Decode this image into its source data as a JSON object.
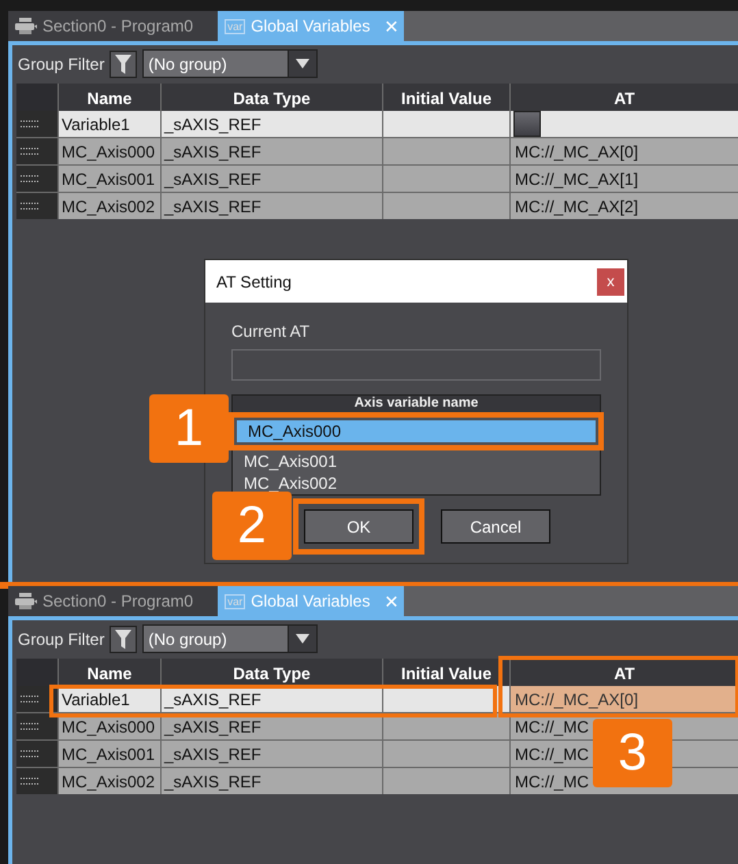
{
  "panels": [
    {
      "tabs": [
        {
          "kind": "program",
          "label": "Section0 - Program0",
          "selected": false
        },
        {
          "kind": "variables",
          "icon_text": "var",
          "label": "Global Variables",
          "close": "✕",
          "selected": true
        }
      ],
      "group_filter": {
        "label": "Group Filter",
        "value": "(No group)"
      },
      "annotated": false,
      "table": {
        "columns": [
          "Name",
          "Data Type",
          "Initial Value",
          "AT"
        ],
        "rows": [
          {
            "name": "Variable1",
            "data_type": "_sAXIS_REF",
            "selected": true,
            "at_picker": true,
            "at_changed": false
          },
          {
            "name": "MC_Axis000",
            "data_type": "_sAXIS_REF",
            "at": "MC://_MC_AX[0]",
            "selected": false,
            "at_picker": false,
            "at_changed": false
          },
          {
            "name": "MC_Axis001",
            "data_type": "_sAXIS_REF",
            "at": "MC://_MC_AX[1]",
            "selected": false,
            "at_picker": false,
            "at_changed": false
          },
          {
            "name": "MC_Axis002",
            "data_type": "_sAXIS_REF",
            "at": "MC://_MC_AX[2]",
            "selected": false,
            "at_picker": false,
            "at_changed": false
          }
        ]
      }
    },
    {
      "tabs": [
        {
          "kind": "program",
          "label": "Section0 - Program0",
          "selected": false
        },
        {
          "kind": "variables",
          "icon_text": "var",
          "label": "Global Variables",
          "close": "✕",
          "selected": true
        }
      ],
      "group_filter": {
        "label": "Group Filter",
        "value": "(No group)"
      },
      "annotated": true,
      "table": {
        "columns": [
          "Name",
          "Data Type",
          "Initial Value",
          "AT"
        ],
        "rows": [
          {
            "name": "Variable1",
            "data_type": "_sAXIS_REF",
            "at": "MC://_MC_AX[0]",
            "selected": true,
            "at_picker": false,
            "at_changed": true
          },
          {
            "name": "MC_Axis000",
            "data_type": "_sAXIS_REF",
            "at": "MC://_MC",
            "selected": false,
            "at_picker": false,
            "at_changed": false
          },
          {
            "name": "MC_Axis001",
            "data_type": "_sAXIS_REF",
            "at": "MC://_MC",
            "selected": false,
            "at_picker": false,
            "at_changed": false
          },
          {
            "name": "MC_Axis002",
            "data_type": "_sAXIS_REF",
            "at": "MC://_MC",
            "selected": false,
            "at_picker": false,
            "at_changed": false
          }
        ]
      }
    }
  ],
  "dialog": {
    "title": "AT Setting",
    "close": "x",
    "current_at_label": "Current AT",
    "list_header": "Axis variable name",
    "items": [
      {
        "label": "MC_Axis000",
        "selected": true
      },
      {
        "label": "MC_Axis001",
        "selected": false
      },
      {
        "label": "MC_Axis002",
        "selected": false
      }
    ],
    "buttons": [
      {
        "label": "OK",
        "highlighted": true
      },
      {
        "label": "Cancel",
        "highlighted": false
      }
    ],
    "annotated": true
  },
  "step_numbers": [
    "1",
    "2",
    "3"
  ]
}
